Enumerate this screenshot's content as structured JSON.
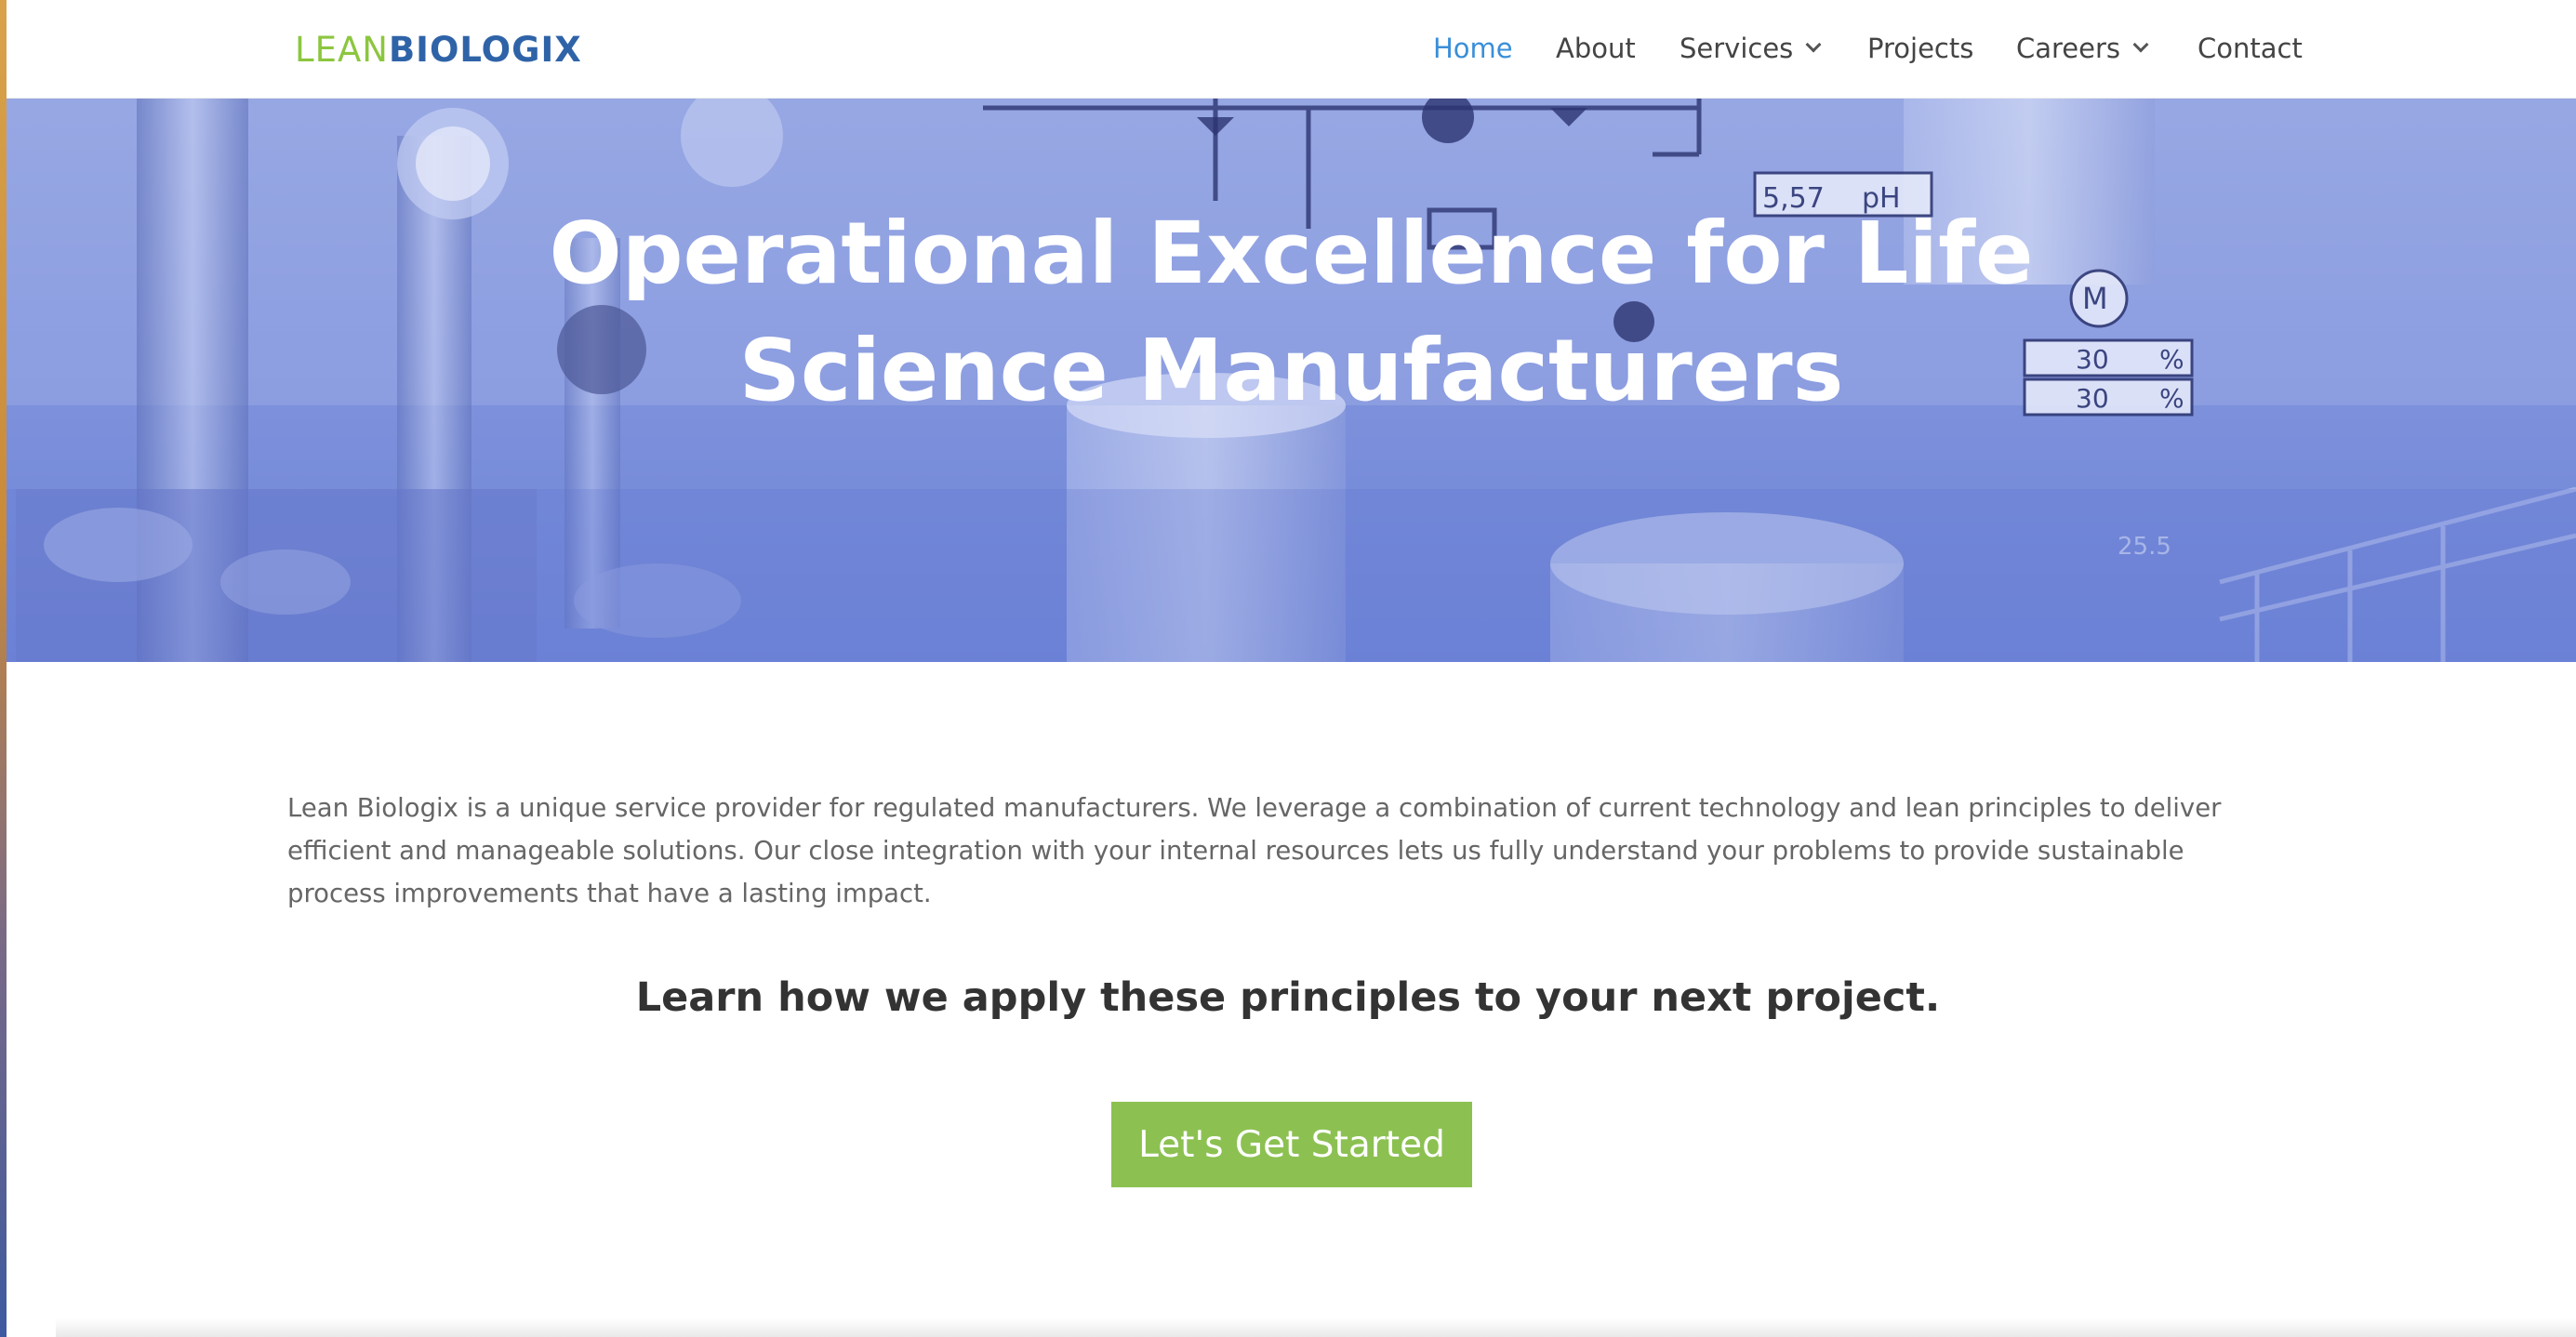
{
  "header": {
    "logo_lean": "LEAN",
    "logo_bio": "BIOLOGIX",
    "nav": [
      {
        "label": "Home",
        "active": true,
        "dropdown": false
      },
      {
        "label": "About",
        "active": false,
        "dropdown": false
      },
      {
        "label": "Services",
        "active": false,
        "dropdown": true
      },
      {
        "label": "Projects",
        "active": false,
        "dropdown": false
      },
      {
        "label": "Careers",
        "active": false,
        "dropdown": true
      },
      {
        "label": "Contact",
        "active": false,
        "dropdown": false
      }
    ]
  },
  "hero": {
    "title_line1": "Operational Excellence for Life",
    "title_line2": "Science Manufacturers",
    "background_readouts": [
      "5,57",
      "pH",
      "30",
      "%",
      "30",
      "%",
      "M",
      "25.5"
    ]
  },
  "main": {
    "intro": "Lean Biologix is a unique service provider for regulated manufacturers. We leverage a combination of current technology and lean principles to deliver efficient and manageable solutions. Our close integration with your internal resources lets us fully understand your problems to provide sustainable process improvements that have a lasting impact.",
    "subhead": "Learn how we apply these principles to your next project.",
    "cta_label": "Let's Get Started"
  },
  "colors": {
    "accent_green": "#8cc152",
    "logo_green": "#8cc63f",
    "logo_blue": "#2f63a8",
    "nav_active": "#3a8fd8",
    "hero_tint": "#7f92dc"
  }
}
